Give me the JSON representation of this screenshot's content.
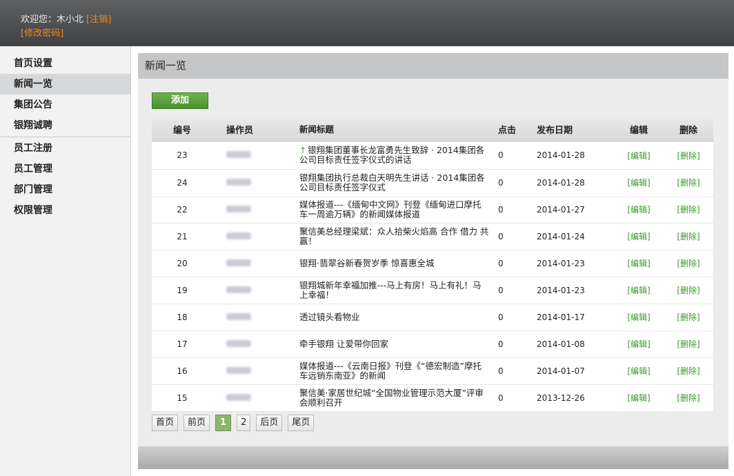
{
  "header": {
    "welcome_label": "欢迎您：",
    "username": "木小北",
    "logout_label": "[注销]",
    "change_password_label": "[修改密码]"
  },
  "sidebar": {
    "items": [
      {
        "label": "首页设置"
      },
      {
        "label": "新闻一览"
      },
      {
        "label": "集团公告"
      },
      {
        "label": "银翔诚聘"
      },
      {
        "label": "员工注册"
      },
      {
        "label": "员工管理"
      },
      {
        "label": "部门管理"
      },
      {
        "label": "权限管理"
      }
    ],
    "active_index": 1
  },
  "main": {
    "title": "新闻一览",
    "add_label": "添加",
    "columns": [
      "编号",
      "操作员",
      "新闻标题",
      "点击",
      "发布日期",
      "编辑",
      "删除"
    ],
    "rows": [
      {
        "id": "23",
        "title": "银翔集团董事长龙富勇先生致辞 · 2014集团各公司目标责任签字仪式的讲话",
        "clicks": "0",
        "date": "2014-01-28",
        "edit": "[编辑]",
        "del": "[删除]",
        "pinned": true
      },
      {
        "id": "24",
        "title": "银翔集团执行总裁白天明先生讲话 · 2014集团各公司目标责任签字仪式",
        "clicks": "0",
        "date": "2014-01-28",
        "edit": "[编辑]",
        "del": "[删除]"
      },
      {
        "id": "22",
        "title": "媒体报道---《缅甸中文网》刊登《缅甸进口摩托车一周逾万辆》的新闻媒体报道",
        "clicks": "0",
        "date": "2014-01-27",
        "edit": "[编辑]",
        "del": "[删除]"
      },
      {
        "id": "21",
        "title": "聚信美总经理梁斌：众人拾柴火焰高 合作 借力 共赢！",
        "clicks": "0",
        "date": "2014-01-24",
        "edit": "[编辑]",
        "del": "[删除]"
      },
      {
        "id": "20",
        "title": "银翔·翡翠谷新春贺岁季 惊喜惠全城",
        "clicks": "0",
        "date": "2014-01-23",
        "edit": "[编辑]",
        "del": "[删除]"
      },
      {
        "id": "19",
        "title": "银翔城新年幸福加推---马上有房！马上有礼！马上幸福！",
        "clicks": "0",
        "date": "2014-01-23",
        "edit": "[编辑]",
        "del": "[删除]"
      },
      {
        "id": "18",
        "title": "透过镜头看物业",
        "clicks": "0",
        "date": "2014-01-17",
        "edit": "[编辑]",
        "del": "[删除]"
      },
      {
        "id": "17",
        "title": "牵手银翔 让爱带你回家",
        "clicks": "0",
        "date": "2014-01-08",
        "edit": "[编辑]",
        "del": "[删除]"
      },
      {
        "id": "16",
        "title": "媒体报道---《云南日报》刊登《“德宏制造”摩托车远销东南亚》的新闻",
        "clicks": "0",
        "date": "2014-01-07",
        "edit": "[编辑]",
        "del": "[删除]"
      },
      {
        "id": "15",
        "title": "聚信美·家居世纪城“全国物业管理示范大厦”评审会顺利召开",
        "clicks": "0",
        "date": "2013-12-26",
        "edit": "[编辑]",
        "del": "[删除]"
      }
    ],
    "pager": {
      "first": "首页",
      "prev": "前页",
      "pages": [
        "1",
        "2"
      ],
      "current": "1",
      "next": "后页",
      "last": "尾页"
    }
  },
  "colors": {
    "accent_orange": "#f08a24",
    "action_green": "#3a9a2a",
    "button_green": "#4a9030"
  }
}
